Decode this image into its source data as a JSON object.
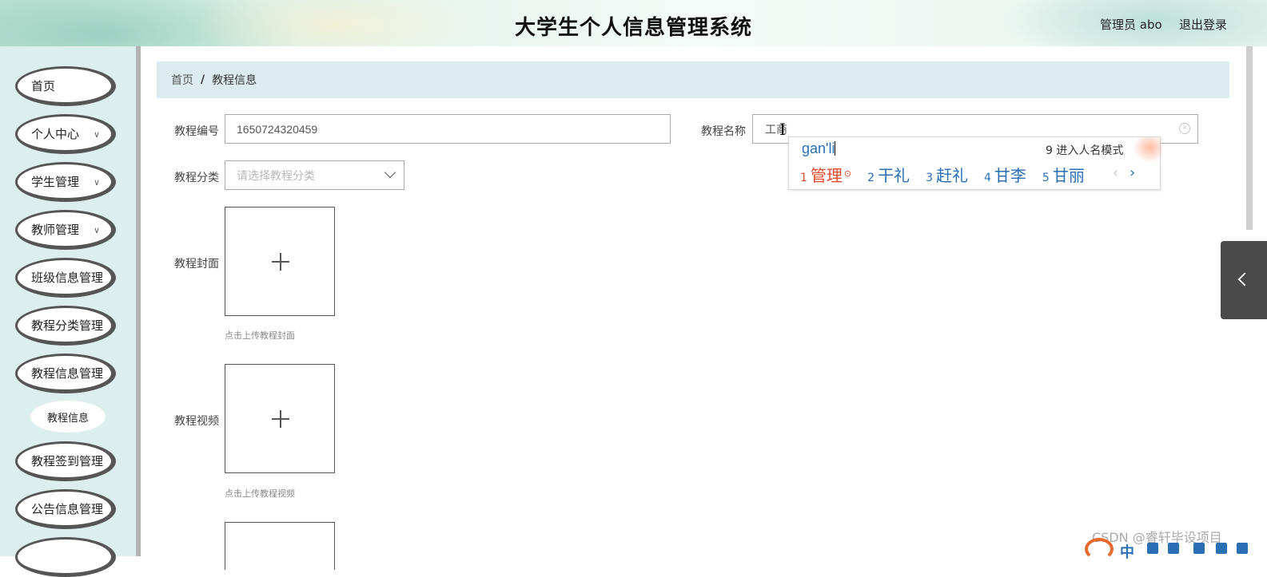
{
  "header": {
    "title": "大学生个人信息管理系统",
    "user_label": "管理员 abo",
    "logout_label": "退出登录"
  },
  "sidebar": {
    "items": [
      {
        "label": "首页"
      },
      {
        "label": "个人中心",
        "chevron": "chevron-down-icon"
      },
      {
        "label": "学生管理",
        "chevron": "chevron-down-icon"
      },
      {
        "label": "教师管理",
        "chevron": "chevron-down-icon"
      },
      {
        "label": "班级信息管理"
      },
      {
        "label": "教程分类管理"
      },
      {
        "label": "教程信息管理"
      },
      {
        "label": "教程签到管理"
      },
      {
        "label": "公告信息管理"
      }
    ],
    "sub_item": "教程信息"
  },
  "breadcrumb": {
    "home": "首页",
    "separator": "/",
    "current": "教程信息"
  },
  "form": {
    "code_label": "教程编号",
    "code_value": "1650724320459",
    "name_label": "教程名称",
    "name_value": "工商",
    "category_label": "教程分类",
    "category_placeholder": "请选择教程分类",
    "cover_label": "教程封面",
    "cover_hint": "点击上传教程封面",
    "video_label": "教程视频",
    "video_hint": "点击上传教程视频"
  },
  "ime": {
    "pinyin": "gan'li",
    "name_mode": "9 进入人名模式",
    "candidates": [
      {
        "num": "1",
        "text": "管理"
      },
      {
        "num": "2",
        "text": "干礼"
      },
      {
        "num": "3",
        "text": "赶礼"
      },
      {
        "num": "4",
        "text": "甘李"
      },
      {
        "num": "5",
        "text": "甘丽"
      }
    ],
    "prev": "‹",
    "next": "›"
  },
  "watermark": "CSDN @睿轩毕设项目",
  "tray": {
    "zh": "中"
  },
  "colors": {
    "sidebar_bg": "#dcefee",
    "breadcrumb_bg": "#dcecee",
    "ime_blue": "#2a6fb4",
    "ime_selected": "#e24b2b"
  }
}
